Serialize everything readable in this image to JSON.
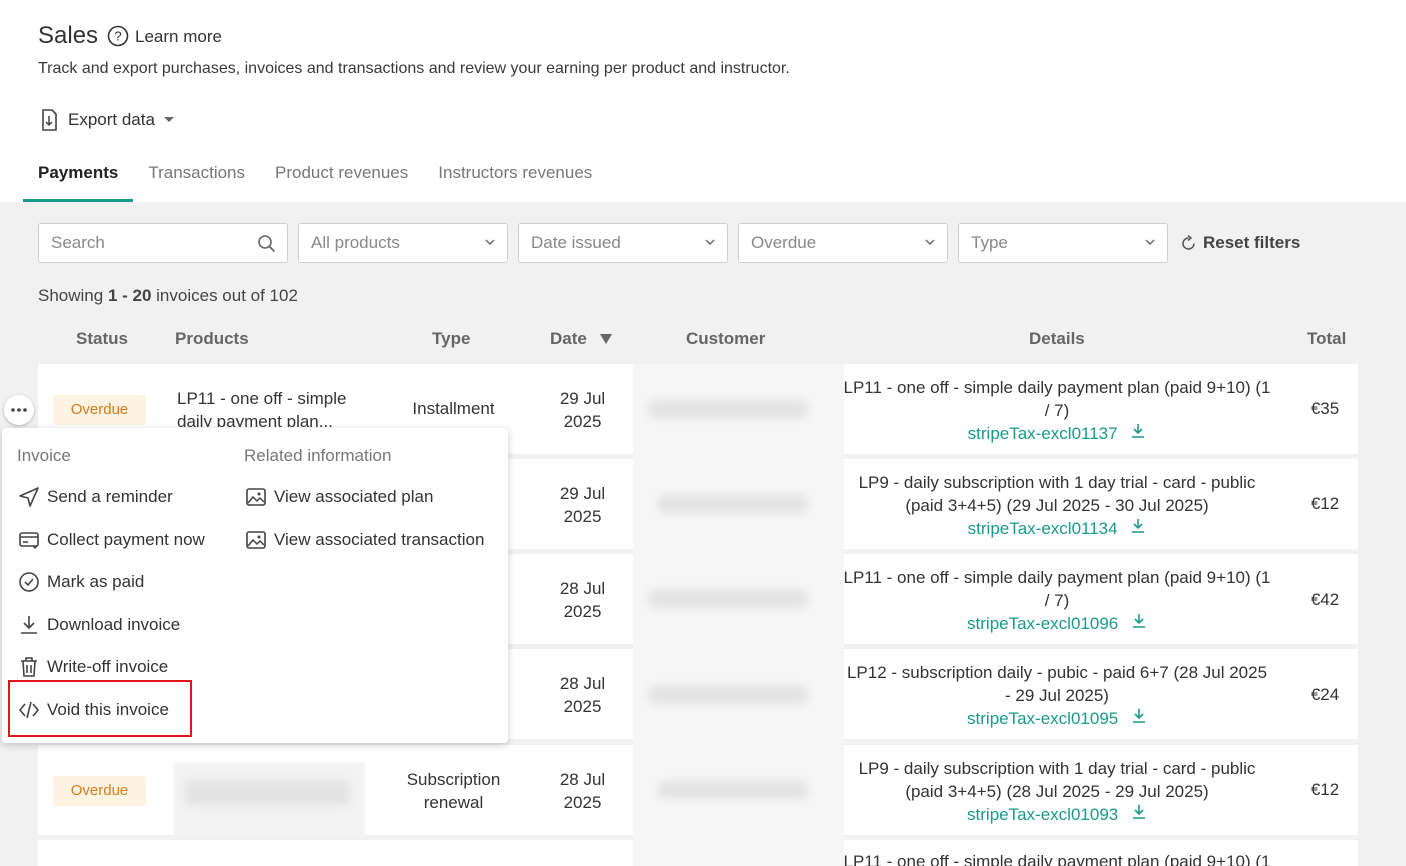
{
  "page": {
    "title": "Sales",
    "learn_more": "Learn more",
    "subtitle": "Track and export purchases, invoices and transactions and review your earning per product and instructor.",
    "export_label": "Export data"
  },
  "tabs": [
    {
      "label": "Payments",
      "active": true
    },
    {
      "label": "Transactions"
    },
    {
      "label": "Product revenues"
    },
    {
      "label": "Instructors revenues"
    }
  ],
  "filters": {
    "search_placeholder": "Search",
    "products": "All products",
    "date": "Date issued",
    "status": "Overdue",
    "type": "Type",
    "reset": "Reset filters"
  },
  "summary": {
    "prefix": "Showing ",
    "range": "1 - 20",
    "suffix": " invoices out of 102"
  },
  "columns": {
    "status": "Status",
    "products": "Products",
    "type": "Type",
    "date": "Date",
    "customer": "Customer",
    "details": "Details",
    "total": "Total"
  },
  "rows": [
    {
      "status": "Overdue",
      "product": "LP11 - one off - simple daily payment plan...",
      "type": "Installment",
      "date_day": "29 Jul",
      "date_year": "2025",
      "details": "LP11 - one off - simple daily payment plan (paid 9+10) (1 / 7)",
      "invoice": "stripeTax-excl01137",
      "total": "€35"
    },
    {
      "date_day": "29 Jul",
      "date_year": "2025",
      "details": "LP9 - daily subscription with 1 day trial - card - public (paid 3+4+5) (29 Jul 2025 - 30 Jul 2025)",
      "invoice": "stripeTax-excl01134",
      "total": "€12"
    },
    {
      "date_day": "28 Jul",
      "date_year": "2025",
      "details": "LP11 - one off - simple daily payment plan (paid 9+10) (1 / 7)",
      "invoice": "stripeTax-excl01096",
      "total": "€42"
    },
    {
      "date_day": "28 Jul",
      "date_year": "2025",
      "details": "LP12 - subscription daily - pubic - paid 6+7 (28 Jul 2025 - 29 Jul 2025)",
      "invoice": "stripeTax-excl01095",
      "total": "€24"
    },
    {
      "status": "Overdue",
      "type_line1": "Subscription",
      "type_line2": "renewal",
      "date_day": "28 Jul",
      "date_year": "2025",
      "details": "LP9 - daily subscription with 1 day trial - card - public (paid 3+4+5) (28 Jul 2025 - 29 Jul 2025)",
      "invoice": "stripeTax-excl01093",
      "total": "€12"
    },
    {
      "details": "LP11 - one off - simple daily payment plan (paid 9+10) (1"
    }
  ],
  "menu": {
    "invoice_header": "Invoice",
    "related_header": "Related information",
    "items": [
      {
        "label": "Send a reminder",
        "icon": "send-icon"
      },
      {
        "label": "Collect payment now",
        "icon": "card-icon"
      },
      {
        "label": "Mark as paid",
        "icon": "check-circle-icon"
      },
      {
        "label": "Download invoice",
        "icon": "download-icon"
      },
      {
        "label": "Write-off invoice",
        "icon": "trash-icon"
      },
      {
        "label": "Void this invoice",
        "icon": "code-icon"
      }
    ],
    "related": [
      {
        "label": "View associated plan",
        "icon": "image-icon"
      },
      {
        "label": "View associated transaction",
        "icon": "image-icon"
      }
    ]
  },
  "colors": {
    "accent": "#1a9a8a",
    "overdue_text": "#d07c1e",
    "overdue_bg": "#fdf3e3",
    "highlight": "#e0141b"
  }
}
